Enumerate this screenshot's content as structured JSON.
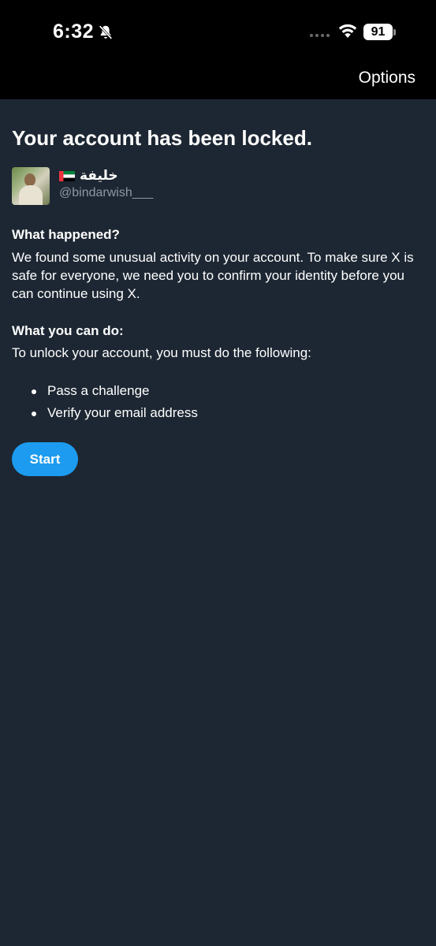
{
  "status_bar": {
    "time": "6:32",
    "battery": "91",
    "icons": [
      "bell-slash-icon",
      "cellular-signal-icon",
      "wifi-icon",
      "battery-icon"
    ]
  },
  "nav": {
    "options_label": "Options"
  },
  "page": {
    "title": "Your account has been locked."
  },
  "profile": {
    "display_name": "خليفة",
    "flag_icon": "uae-flag-icon",
    "handle": "@bindarwish___"
  },
  "what_happened": {
    "heading": "What happened?",
    "body": "We found some unusual activity on your account. To make sure X is safe for everyone, we need you to confirm your identity before you can continue using X."
  },
  "what_you_can_do": {
    "heading": "What you can do:",
    "body": "To unlock your account, you must do the following:",
    "steps": [
      "Pass a challenge",
      "Verify your email address"
    ]
  },
  "actions": {
    "start_label": "Start"
  },
  "colors": {
    "background": "#1d2733",
    "accent": "#1d9bf0",
    "secondary_text": "#8b98a5"
  }
}
